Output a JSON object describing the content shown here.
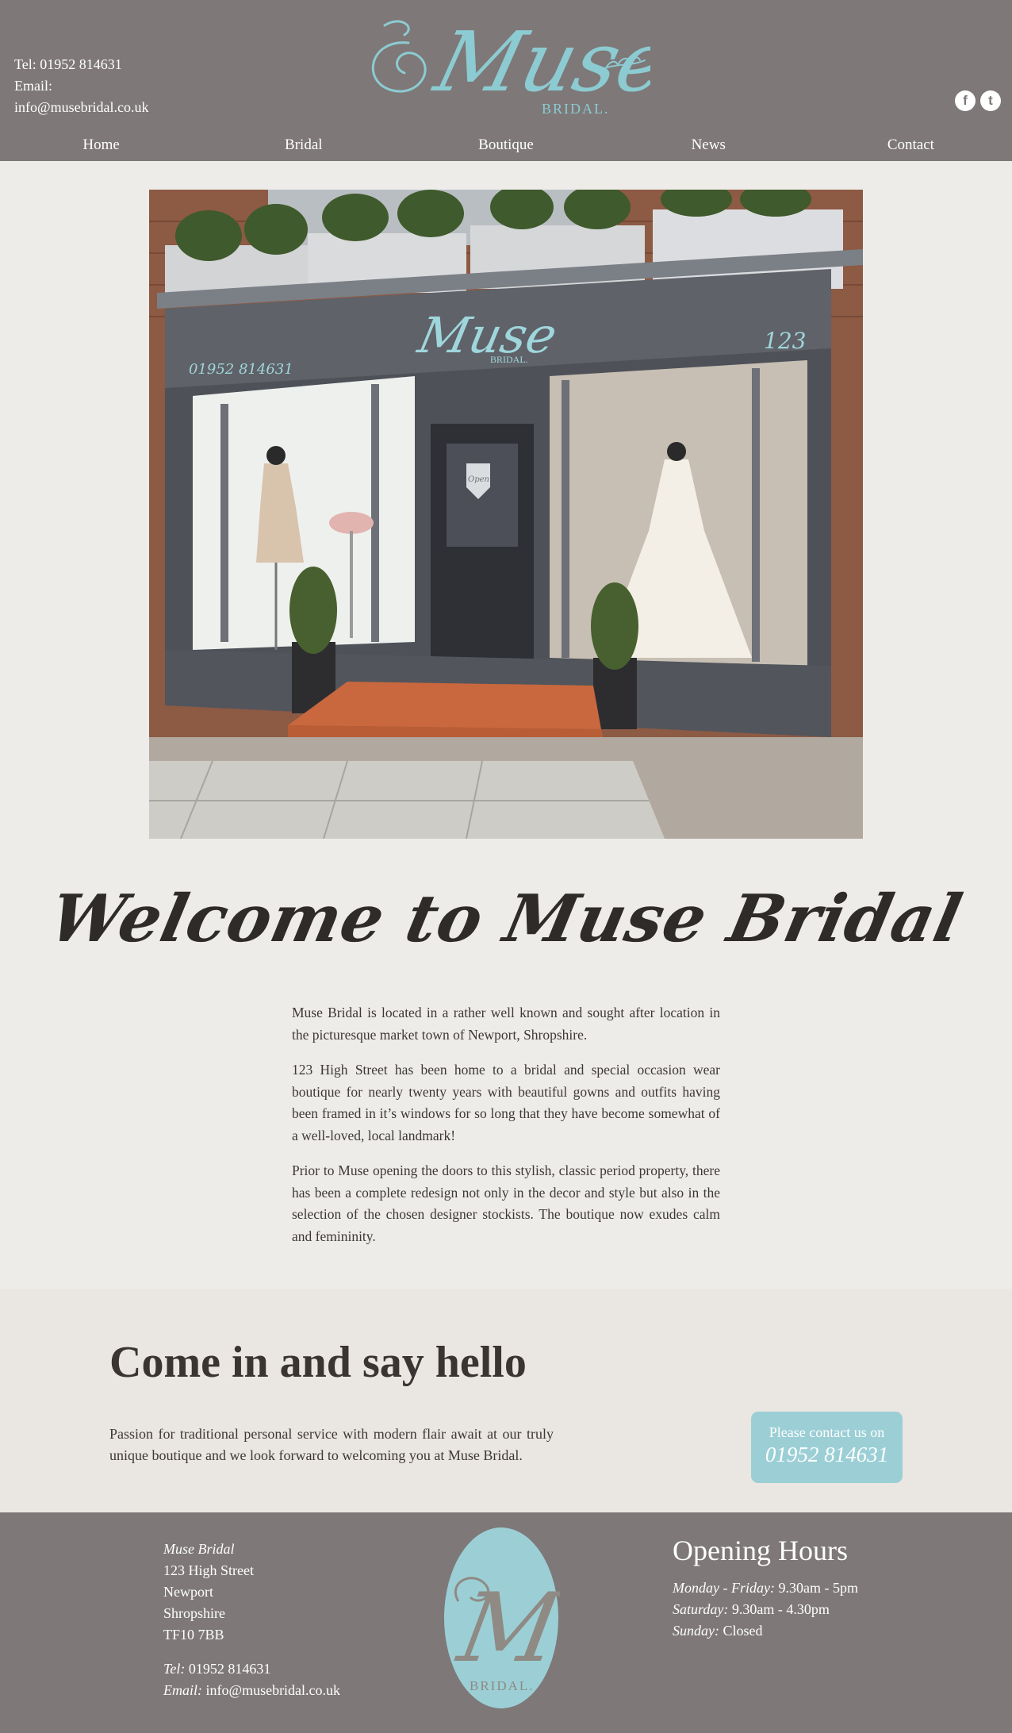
{
  "header": {
    "tel_line": "Tel: 01952 814631",
    "email_label": "Email:",
    "email": "info@musebridal.co.uk",
    "logo_text": "Muse",
    "logo_sub": "BRIDAL.",
    "social": [
      {
        "icon": "facebook-icon",
        "glyph": "f"
      },
      {
        "icon": "twitter-icon",
        "glyph": "t"
      }
    ]
  },
  "nav": {
    "items": [
      "Home",
      "Bridal",
      "Boutique",
      "News",
      "Contact"
    ]
  },
  "hero": {
    "sign_logo": "Muse",
    "sign_sub": "BRIDAL.",
    "sign_phone": "01952 814631",
    "sign_number": "123",
    "door_sign": "Open"
  },
  "welcome": {
    "title": "Welcome to Muse Bridal",
    "paragraphs": [
      "Muse Bridal is located in a rather well known and sought after location in the picturesque market town of Newport, Shropshire.",
      "123 High Street has been home to a bridal and special occasion wear boutique for nearly twenty years with beautiful gowns and outfits having been framed in it’s windows for so long that they have become somewhat of a well-loved, local landmark!",
      "Prior to Muse opening the doors to this stylish, classic period property, there has been a complete redesign not only in the decor and style but also in the selection of the chosen designer stockists. The boutique now exudes calm and femininity."
    ]
  },
  "hello": {
    "title": "Come in and say hello",
    "text": "Passion for traditional personal service with modern flair await at our truly unique boutique and we look forward to welcoming you at Muse Bridal.",
    "cta_label": "Please contact us on",
    "cta_phone": "01952 814631"
  },
  "footer": {
    "name": "Muse Bridal",
    "street": "123 High Street",
    "town": "Newport",
    "county": "Shropshire",
    "postcode": "TF10 7BB",
    "tel_label": "Tel:",
    "tel": "01952 814631",
    "email_label": "Email:",
    "email": "info@musebridal.co.uk",
    "logo_letter": "M",
    "logo_sub": "BRIDAL.",
    "hours_title": "Opening Hours",
    "hours": [
      {
        "day": "Monday - Friday:",
        "time": "9.30am - 5pm"
      },
      {
        "day": "Saturday:",
        "time": "9.30am - 4.30pm"
      },
      {
        "day": "Sunday:",
        "time": "Closed"
      }
    ]
  },
  "colors": {
    "header_bg": "#7e7878",
    "accent_teal": "#8ccbd1",
    "page_bg": "#eeece9",
    "hello_bg": "#eae6e1",
    "cta_bg": "#9bcfd5"
  }
}
